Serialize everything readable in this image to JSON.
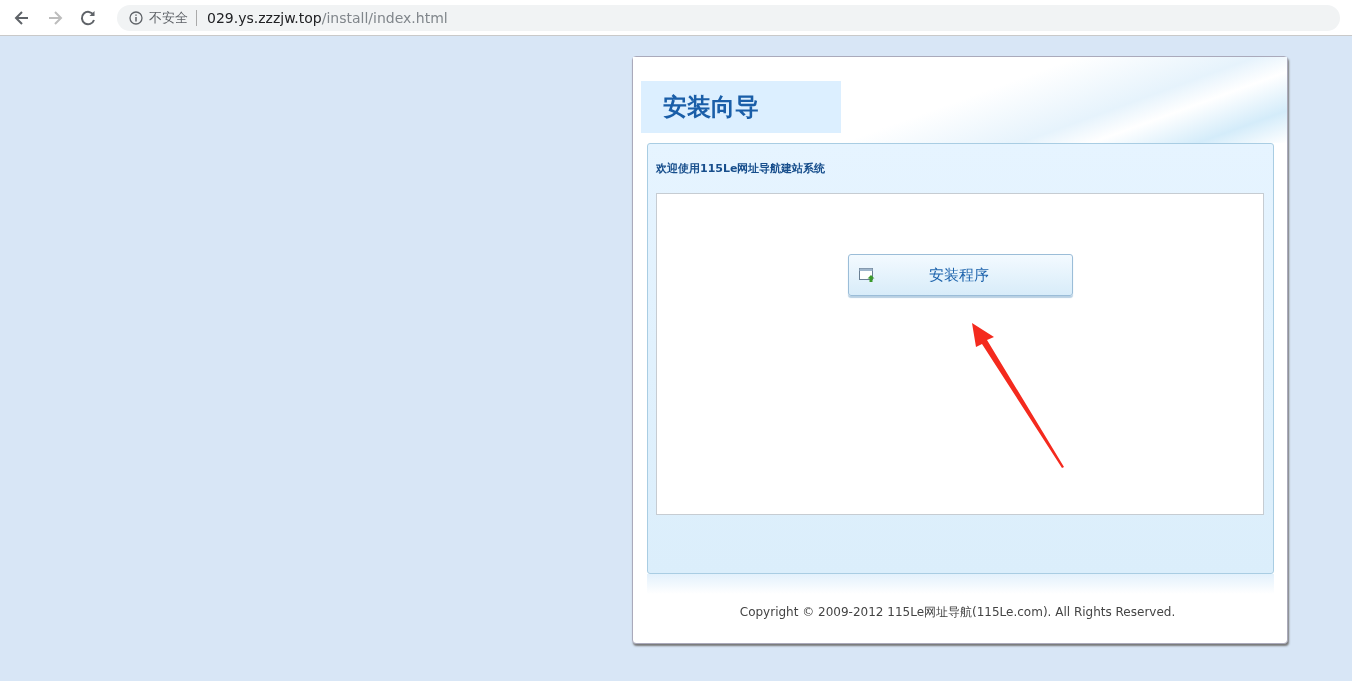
{
  "browser": {
    "security_label": "不安全",
    "url_host": "029.ys.zzzjw.top",
    "url_path": "/install/index.html"
  },
  "wizard": {
    "title": "安装向导",
    "welcome": "欢迎使用115Le网址导航建站系统",
    "install_button": "安装程序",
    "copyright": "Copyright © 2009-2012 115Le网址导航(115Le.com). All Rights Reserved."
  }
}
